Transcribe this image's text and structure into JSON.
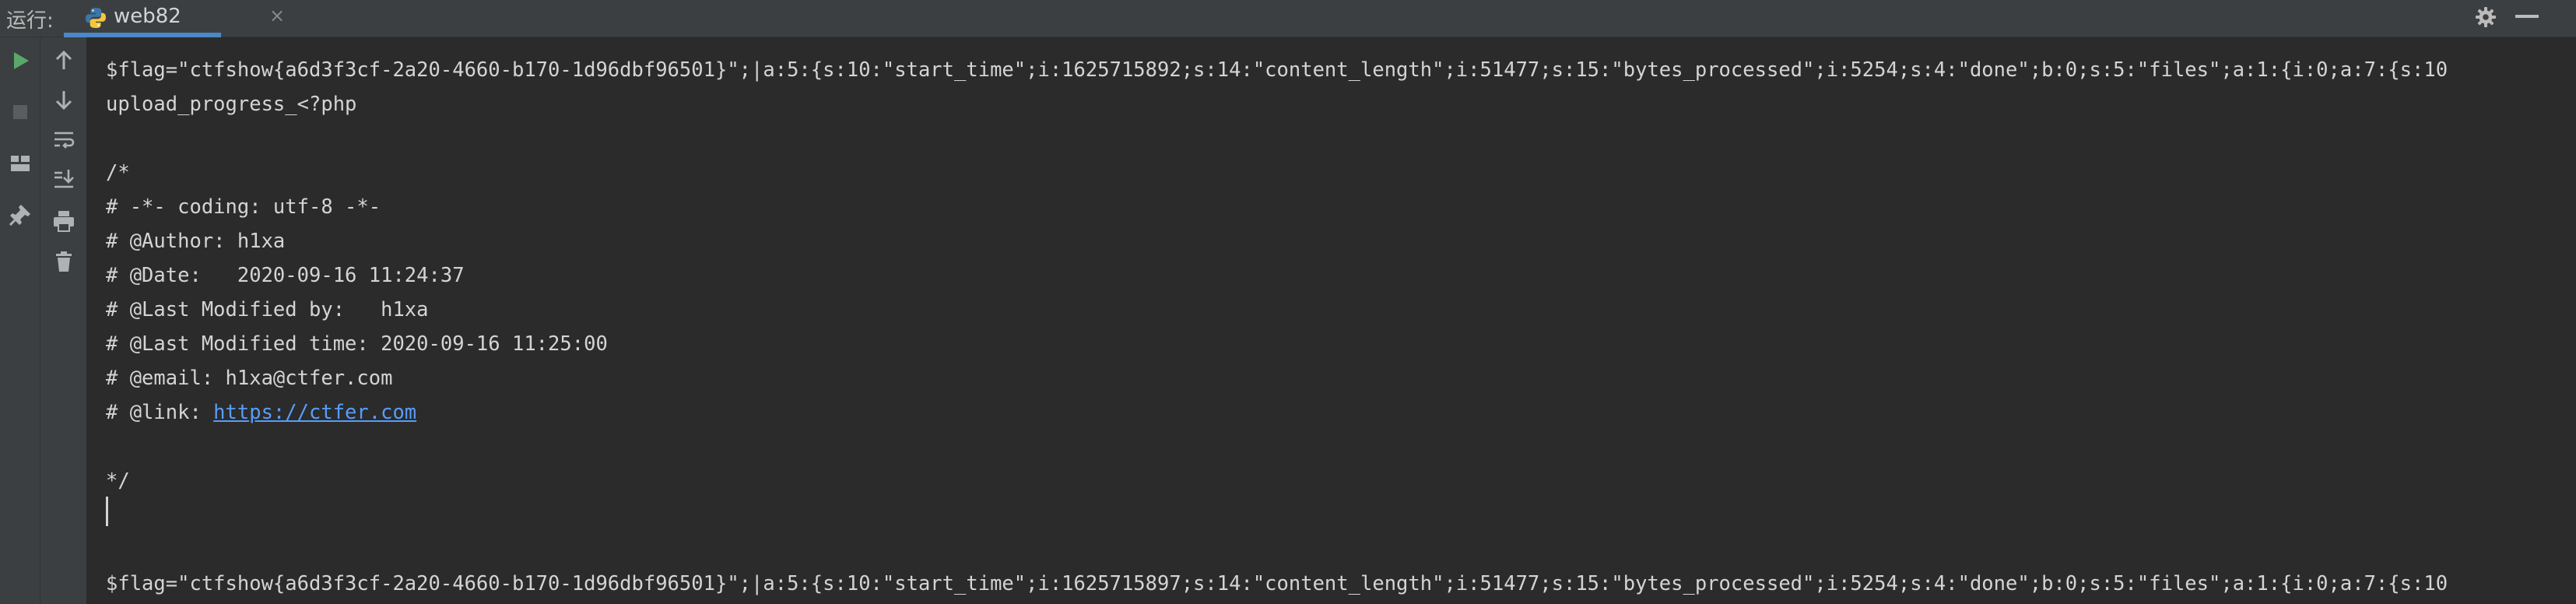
{
  "run_panel": {
    "run_label": "运行:",
    "tab": {
      "label": "web82",
      "close_glyph": "×"
    },
    "accent_color": "#4a88c7"
  },
  "console": {
    "lines": [
      "$flag=\"ctfshow{a6d3f3cf-2a20-4660-b170-1d96dbf96501}\";|a:5:{s:10:\"start_time\";i:1625715892;s:14:\"content_length\";i:51477;s:15:\"bytes_processed\";i:5254;s:4:\"done\";b:0;s:5:\"files\";a:1:{i:0;a:7:{s:10",
      "upload_progress_<?php",
      "",
      "/*",
      "# -*- coding: utf-8 -*-",
      "# @Author: h1xa",
      "# @Date:   2020-09-16 11:24:37",
      "# @Last Modified by:   h1xa",
      "# @Last Modified time: 2020-09-16 11:25:00",
      "# @email: h1xa@ctfer.com",
      "# @link: ",
      "",
      "*/",
      "",
      "",
      "$flag=\"ctfshow{a6d3f3cf-2a20-4660-b170-1d96dbf96501}\";|a:5:{s:10:\"start_time\";i:1625715897;s:14:\"content_length\";i:51477;s:15:\"bytes_processed\";i:5254;s:4:\"done\";b:0;s:5:\"files\";a:1:{i:0;a:7:{s:10"
    ],
    "link_text": "https://ctfer.com",
    "link_color": "#589df6"
  },
  "icons": {
    "strip1": [
      "run-icon",
      "stop-icon",
      "layout-icon",
      "pin-icon"
    ],
    "strip2": [
      "arrow-up-icon",
      "arrow-down-icon",
      "soft-wrap-icon",
      "scroll-to-end-icon",
      "print-icon",
      "trash-icon"
    ],
    "header": [
      "python-icon",
      "gear-icon",
      "minimize-icon"
    ]
  }
}
